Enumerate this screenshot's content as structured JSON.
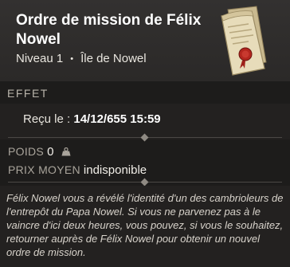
{
  "header": {
    "title": "Ordre de mission de Félix Nowel",
    "level": "Niveau 1",
    "separator": "•",
    "location": "Île de Nowel",
    "icon": "scroll-with-red-seal-icon"
  },
  "effect": {
    "section_title": "EFFET",
    "received_label": "Reçu le :",
    "received_value": "14/12/655 15:59"
  },
  "stats": {
    "weight_label": "POIDS",
    "weight_value": "0",
    "weight_icon": "weight-icon",
    "price_label": "PRIX MOYEN",
    "price_value": "indisponible"
  },
  "description": "Félix Nowel vous a révélé l'identité d'un des cambrioleurs de l'entrepôt du Papa Nowel. Si vous ne parvenez pas à le vaincre d'ici deux heures, vous pouvez, si vous le souhaitez, retourner auprès de Félix Nowel pour obtenir un nouvel ordre de mission.",
  "colors": {
    "background": "#1d1c1b",
    "header": "#302e2d",
    "accent_seal": "#b3261e"
  }
}
